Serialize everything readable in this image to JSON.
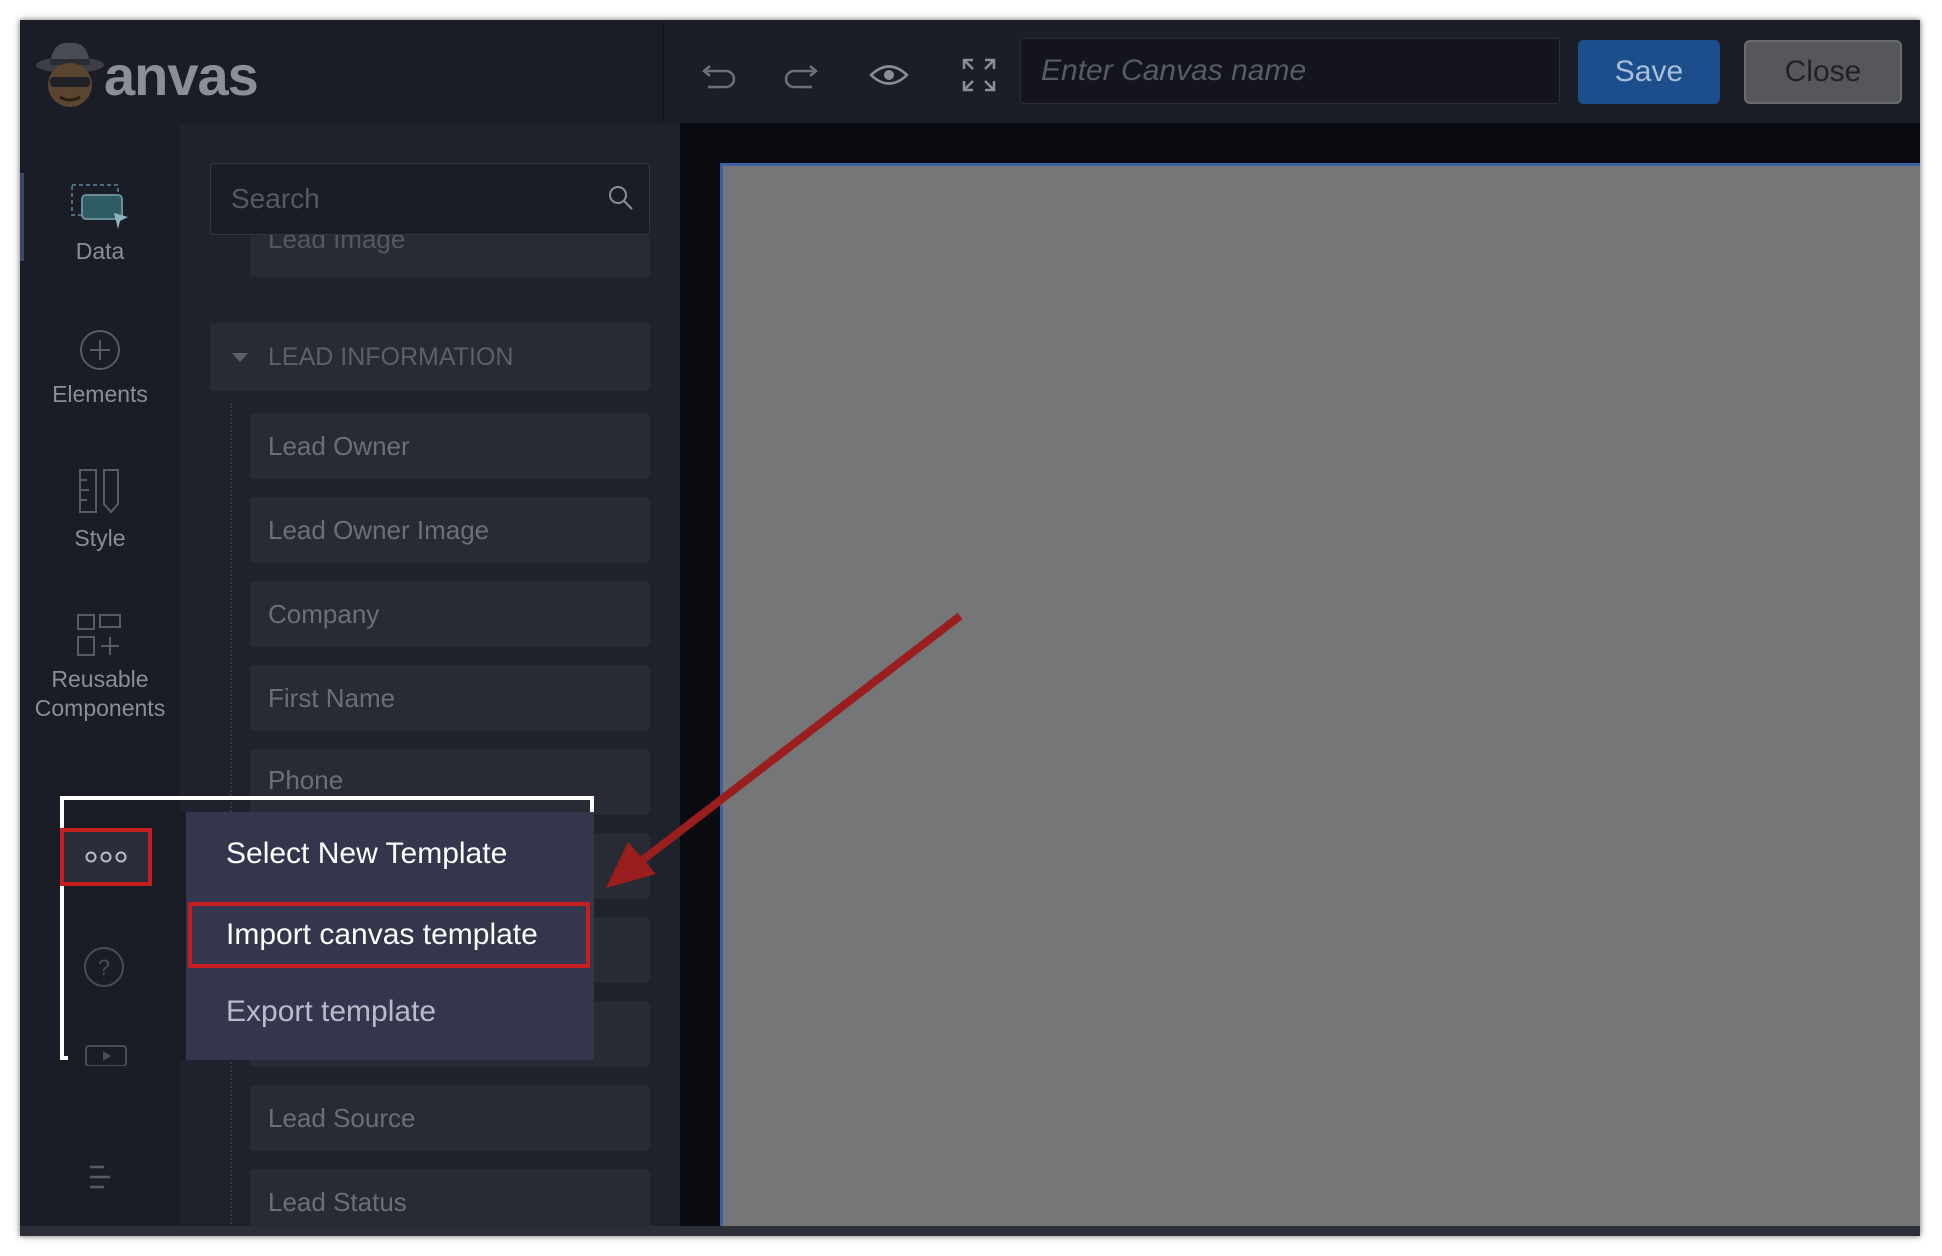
{
  "app": {
    "logo_text": "anvas"
  },
  "toolbar": {
    "canvas_name_placeholder": "Enter Canvas name",
    "save_label": "Save",
    "close_label": "Close"
  },
  "nav": {
    "data": "Data",
    "elements": "Elements",
    "style": "Style",
    "reusable_line1": "Reusable",
    "reusable_line2": "Components"
  },
  "panel": {
    "search_placeholder": "Search",
    "partial_field": "Lead Image",
    "section_title": "LEAD INFORMATION",
    "fields": [
      "Lead Owner",
      "Lead Owner Image",
      "Company",
      "First Name",
      "Phone",
      "",
      "",
      "",
      "Lead Source",
      "Lead Status"
    ]
  },
  "popup_menu": {
    "items": [
      "Select New Template",
      "Import canvas template",
      "Export template"
    ]
  },
  "colors": {
    "accent_save": "#1c4d8c",
    "highlight_red": "#c51f1f",
    "canvas_gray": "#757678",
    "menu_bg": "#33364c"
  }
}
